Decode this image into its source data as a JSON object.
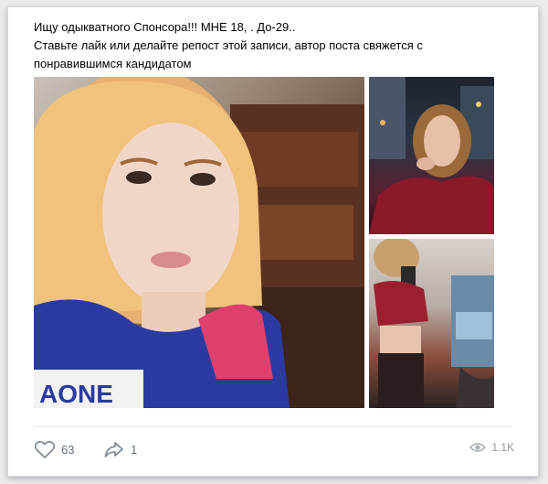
{
  "post": {
    "line1": "Ищу одыкватного Спонсора!!! МНЕ 18, . До-29..",
    "line2": "Ставьте лайк или делайте репост этой записи, автор поста свяжется с",
    "line3": "понравившимся кандидатом"
  },
  "footer": {
    "likes": "63",
    "shares": "1",
    "views": "1.1K"
  },
  "photos": {
    "main_shirt_text": "AONE"
  },
  "icons": {
    "like": "heart-icon",
    "share": "share-arrow-icon",
    "views": "eye-icon"
  },
  "colors": {
    "icon": "#818c99",
    "text": "#000000",
    "muted": "#909499"
  }
}
